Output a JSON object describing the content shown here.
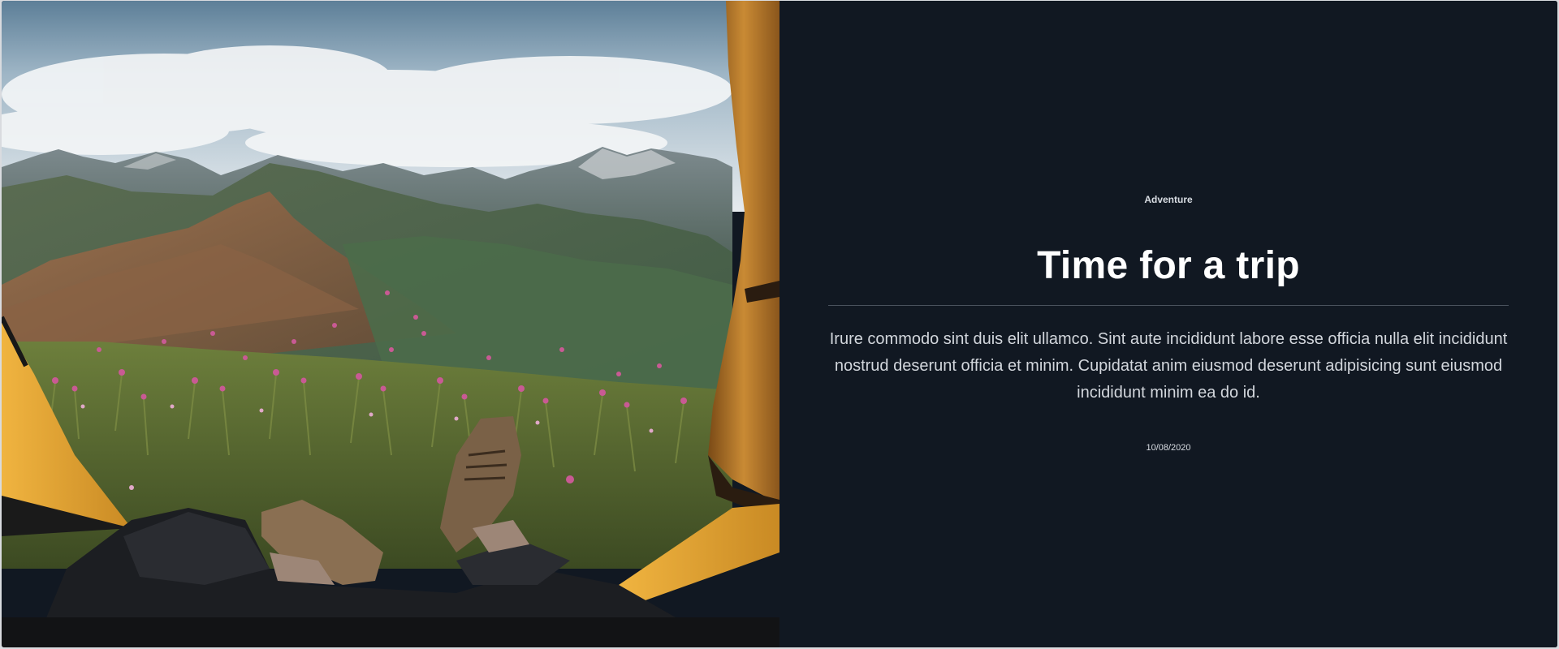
{
  "post": {
    "image_alt": "View from a tent onto green mountains with pink wildflowers and hiking boots",
    "category": "Adventure",
    "title": "Time for a trip",
    "description": "Irure commodo sint duis elit ullamco. Sint aute incididunt labore esse officia nulla elit incididunt nostrud deserunt officia et minim. Cupidatat anim eiusmod deserunt adipisicing sunt eiusmod incididunt minim ea do id.",
    "date": "10/08/2020"
  },
  "colors": {
    "panel_background": "#111822",
    "title": "#ffffff",
    "text": "#d2d6dc",
    "divider": "#4a525d",
    "tent_fabric": "#e0a334"
  }
}
